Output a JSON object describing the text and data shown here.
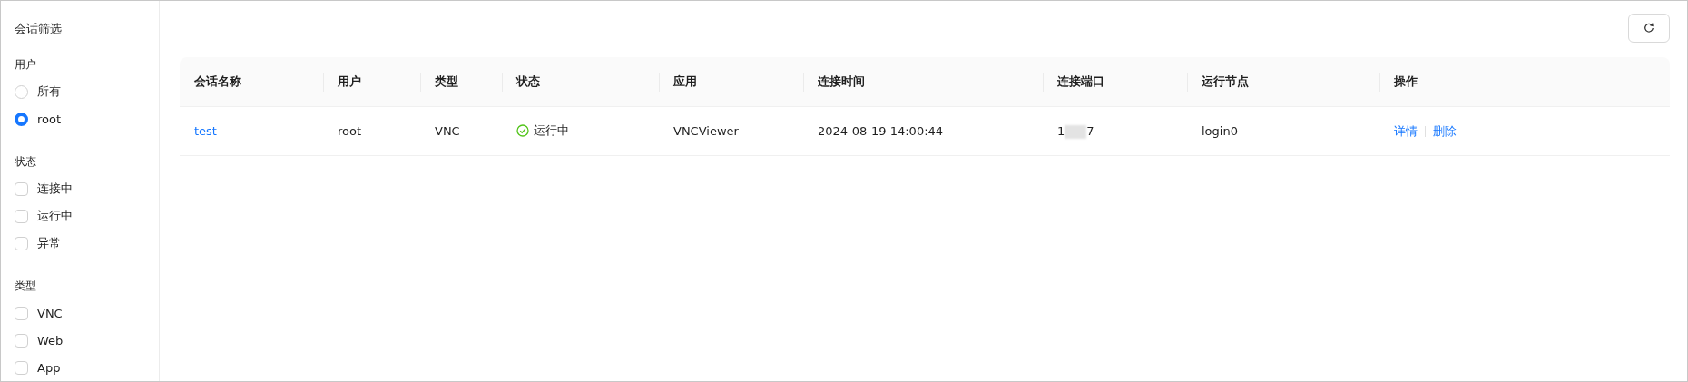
{
  "sidebar": {
    "title": "会话筛选",
    "groups": [
      {
        "label": "用户",
        "kind": "radio",
        "options": [
          {
            "label": "所有",
            "selected": false
          },
          {
            "label": "root",
            "selected": true
          }
        ]
      },
      {
        "label": "状态",
        "kind": "checkbox",
        "options": [
          {
            "label": "连接中",
            "checked": false
          },
          {
            "label": "运行中",
            "checked": false
          },
          {
            "label": "异常",
            "checked": false
          }
        ]
      },
      {
        "label": "类型",
        "kind": "checkbox",
        "options": [
          {
            "label": "VNC",
            "checked": false
          },
          {
            "label": "Web",
            "checked": false
          },
          {
            "label": "App",
            "checked": false
          }
        ]
      }
    ]
  },
  "table": {
    "columns": [
      "会话名称",
      "用户",
      "类型",
      "状态",
      "应用",
      "连接时间",
      "连接端口",
      "运行节点",
      "操作"
    ],
    "rows": [
      {
        "name": "test",
        "user": "root",
        "type": "VNC",
        "status": {
          "kind": "running",
          "label": "运行中"
        },
        "app": "VNCViewer",
        "time": "2024-08-19 14:00:44",
        "port": {
          "prefix": "1",
          "suffix": "7",
          "redacted": true
        },
        "node": "login0",
        "actions": [
          "详情",
          "删除"
        ]
      }
    ]
  }
}
